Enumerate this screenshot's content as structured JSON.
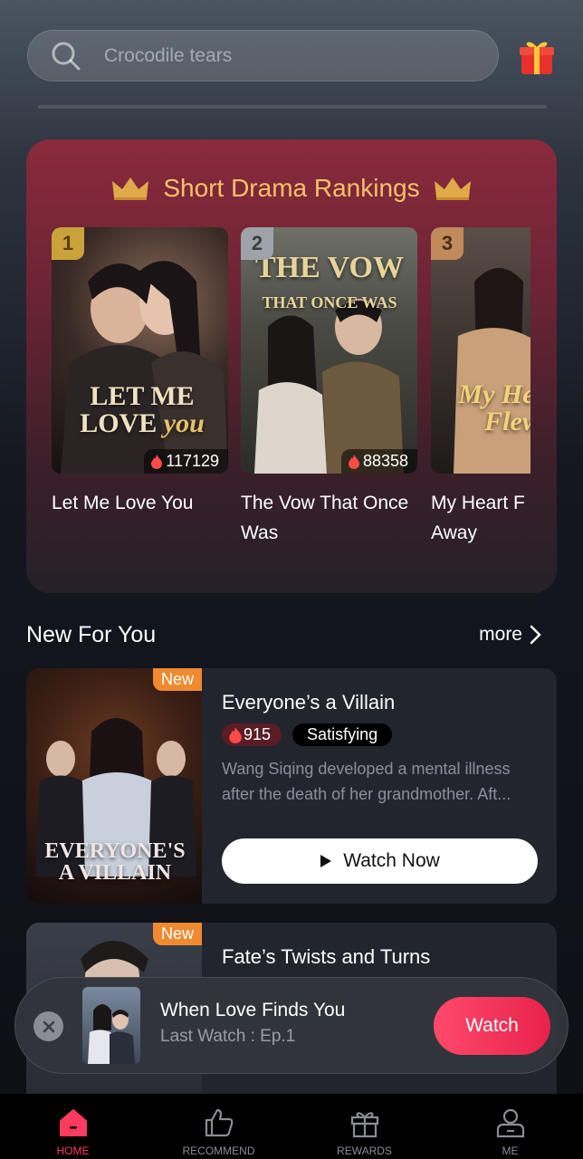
{
  "search": {
    "placeholder": "Crocodile tears"
  },
  "rankings": {
    "title": "Short Drama Rankings",
    "items": [
      {
        "rank": "1",
        "name": "Let Me Love You",
        "views": "117129",
        "poster_text": "LET ME LOVE you",
        "accent": "#c9a23a"
      },
      {
        "rank": "2",
        "name": "The Vow That Once Was",
        "views": "88358",
        "poster_text": "THE VOW THAT ONCE WAS",
        "accent": "#9ea3a9"
      },
      {
        "rank": "3",
        "name": "My Heart F Away",
        "views": "",
        "poster_text": "My Heart Flew",
        "accent": "#c08a5a"
      }
    ]
  },
  "new_for_you": {
    "title": "New For You",
    "more_label": "more",
    "cards": [
      {
        "badge": "New",
        "title": "Everyone’s a Villain",
        "hot": "915",
        "genre": "Satisfying",
        "description": "Wang Siqing developed a mental illness after the death of her grandmother. Aft...",
        "watch_label": "Watch Now",
        "poster_text": "EVERYONE'S A VILLAIN"
      },
      {
        "badge": "New",
        "title": "Fate’s Twists and Turns"
      }
    ]
  },
  "continue_watching": {
    "title": "When Love Finds You",
    "last_watch": "Last Watch : Ep.1",
    "watch_label": "Watch"
  },
  "nav": {
    "home": "HOME",
    "recommend": "RECOMMEND",
    "rewards": "REWARDS",
    "me": "ME"
  },
  "colors": {
    "accent": "#ff3b5f",
    "gold": "#f5c26b",
    "badge": "#f08a30"
  }
}
